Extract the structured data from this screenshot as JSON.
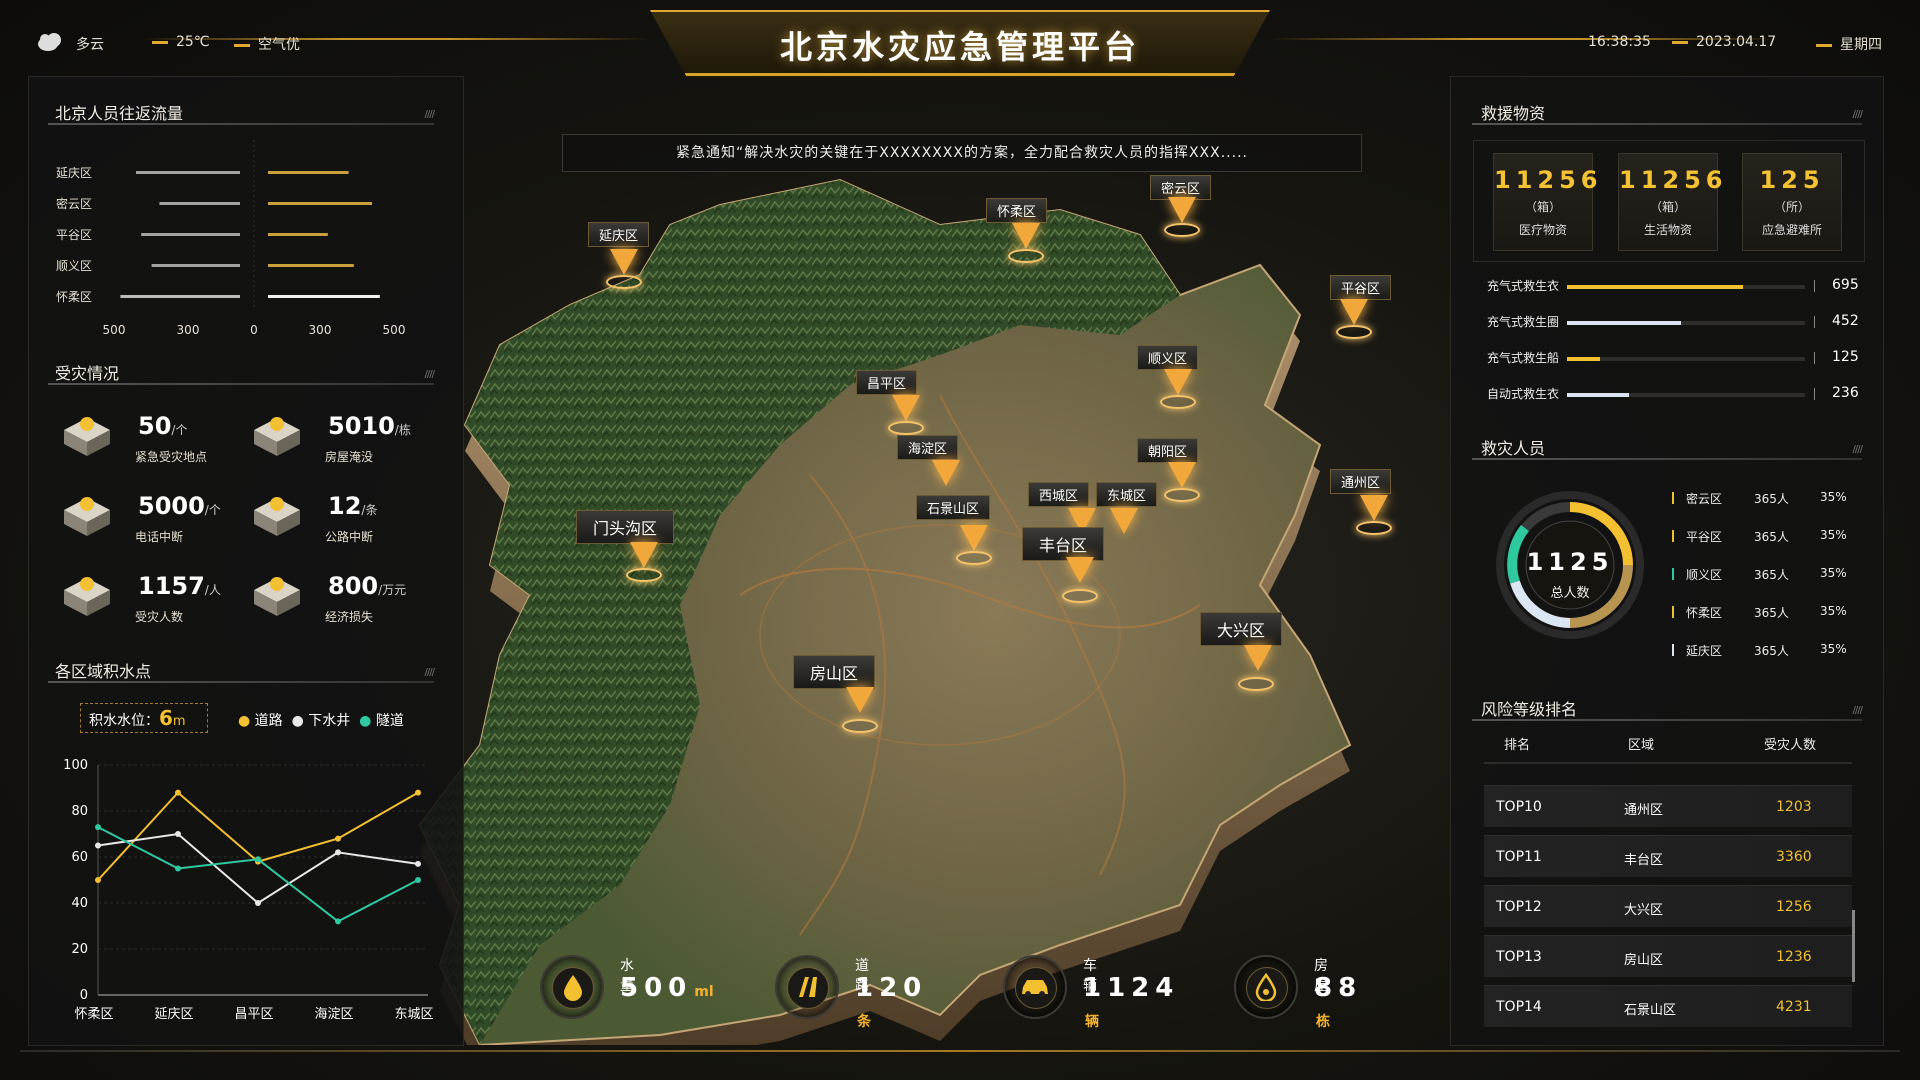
{
  "header": {
    "title": "北京水灾应急管理平台",
    "weather": "多云",
    "temperature": "25℃",
    "air": "空气优",
    "time": "16:38:35",
    "date": "2023.04.17",
    "weekday": "星期四"
  },
  "notice": "紧急通知“解决水灾的关键在于XXXXXXXX的方案，全力配合救灾人员的指挥XXX.....",
  "flow": {
    "title": "北京人员往返流量",
    "districts": [
      "延庆区",
      "密云区",
      "平谷区",
      "顺义区",
      "怀柔区"
    ],
    "axis": [
      "500",
      "300",
      "0",
      "300",
      "500"
    ],
    "left_values": [
      400,
      310,
      380,
      340,
      460
    ],
    "right_values": [
      310,
      400,
      230,
      330,
      430
    ]
  },
  "damage": {
    "title": "受灾情况",
    "items": [
      {
        "value": "50",
        "unit": "/个",
        "label": "紧急受灾地点"
      },
      {
        "value": "5010",
        "unit": "/栋",
        "label": "房屋淹没"
      },
      {
        "value": "5000",
        "unit": "/个",
        "label": "电话中断"
      },
      {
        "value": "12",
        "unit": "/条",
        "label": "公路中断"
      },
      {
        "value": "1157",
        "unit": "/人",
        "label": "受灾人数"
      },
      {
        "value": "800",
        "unit": "/万元",
        "label": "经济损失"
      }
    ]
  },
  "water": {
    "title": "各区域积水点",
    "level_label": "积水水位：",
    "level_value": "6",
    "level_unit": "m",
    "legend": [
      "道路",
      "下水井",
      "隧道"
    ]
  },
  "chart_data": {
    "type": "line",
    "categories": [
      "怀柔区",
      "延庆区",
      "昌平区",
      "海淀区",
      "东城区"
    ],
    "ylim": [
      0,
      100
    ],
    "yticks": [
      "0",
      "20",
      "40",
      "60",
      "80",
      "100"
    ],
    "series": [
      {
        "name": "道路",
        "values": [
          50,
          88,
          58,
          68,
          88
        ],
        "color": "#f2c030"
      },
      {
        "name": "下水井",
        "values": [
          65,
          70,
          40,
          62,
          57
        ],
        "color": "#e8e8e8"
      },
      {
        "name": "隧道",
        "values": [
          73,
          55,
          59,
          32,
          50
        ],
        "color": "#2fc9a0"
      }
    ]
  },
  "map": {
    "districts": [
      "延庆区",
      "怀柔区",
      "密云区",
      "平谷区",
      "昌平区",
      "顺义区",
      "海淀区",
      "朝阳区",
      "门头沟区",
      "石景山区",
      "西城区",
      "东城区",
      "丰台区",
      "通州区",
      "大兴区",
      "房山区"
    ]
  },
  "bottom_stats": [
    {
      "label": "水量",
      "value": "500",
      "unit": "ml"
    },
    {
      "label": "道路",
      "value": "120",
      "unit": "条"
    },
    {
      "label": "车辆",
      "value": "1124",
      "unit": "辆"
    },
    {
      "label": "房屋",
      "value": "88",
      "unit": "栋"
    }
  ],
  "supplies": {
    "title": "救援物资",
    "boxes": [
      {
        "value": "11256",
        "unit": "（箱）",
        "label": "医疗物资"
      },
      {
        "value": "11256",
        "unit": "（箱）",
        "label": "生活物资"
      },
      {
        "value": "125",
        "unit": "（所）",
        "label": "应急避难所"
      }
    ],
    "items": [
      {
        "label": "充气式救生衣",
        "value": "695",
        "pct": 0.74,
        "color": "#f2c030"
      },
      {
        "label": "充气式救生圈",
        "value": "452",
        "pct": 0.48,
        "color": "#dce6f2"
      },
      {
        "label": "充气式救生船",
        "value": "125",
        "pct": 0.14,
        "color": "#f2c030"
      },
      {
        "label": "自动式救生衣",
        "value": "236",
        "pct": 0.26,
        "color": "#dce6f2"
      }
    ]
  },
  "rescuers": {
    "title": "救灾人员",
    "total": "1125",
    "total_label": "总人数",
    "rows": [
      {
        "name": "密云区",
        "count": "365人",
        "pct": "35%"
      },
      {
        "name": "平谷区",
        "count": "365人",
        "pct": "35%"
      },
      {
        "name": "顺义区",
        "count": "365人",
        "pct": "35%"
      },
      {
        "name": "怀柔区",
        "count": "365人",
        "pct": "35%"
      },
      {
        "name": "延庆区",
        "count": "365人",
        "pct": "35%"
      }
    ]
  },
  "risk": {
    "title": "风险等级排名",
    "headers": [
      "排名",
      "区域",
      "受灾人数"
    ],
    "rows": [
      {
        "rank": "TOP10",
        "area": "通州区",
        "count": "1203"
      },
      {
        "rank": "TOP11",
        "area": "丰台区",
        "count": "3360"
      },
      {
        "rank": "TOP12",
        "area": "大兴区",
        "count": "1256"
      },
      {
        "rank": "TOP13",
        "area": "房山区",
        "count": "1236"
      },
      {
        "rank": "TOP14",
        "area": "石景山区",
        "count": "4231"
      }
    ]
  }
}
